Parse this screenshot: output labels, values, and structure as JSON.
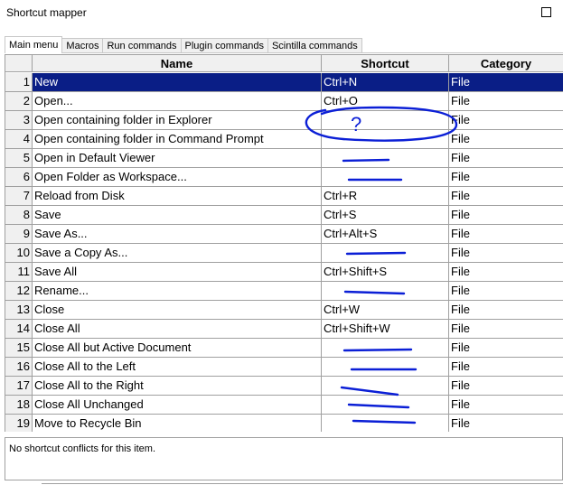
{
  "window": {
    "title": "Shortcut mapper"
  },
  "tabs": [
    {
      "label": "Main menu",
      "active": true
    },
    {
      "label": "Macros",
      "active": false
    },
    {
      "label": "Run commands",
      "active": false
    },
    {
      "label": "Plugin commands",
      "active": false
    },
    {
      "label": "Scintilla commands",
      "active": false
    }
  ],
  "table": {
    "columns": {
      "name": "Name",
      "shortcut": "Shortcut",
      "category": "Category"
    },
    "selected_row": 1,
    "rows": [
      {
        "num": "1",
        "name": "New",
        "shortcut": "Ctrl+N",
        "category": "File"
      },
      {
        "num": "2",
        "name": "Open...",
        "shortcut": "Ctrl+O",
        "category": "File"
      },
      {
        "num": "3",
        "name": "Open containing folder in Explorer",
        "shortcut": "",
        "category": "File"
      },
      {
        "num": "4",
        "name": "Open containing folder in Command Prompt",
        "shortcut": "",
        "category": "File"
      },
      {
        "num": "5",
        "name": "Open in Default Viewer",
        "shortcut": "",
        "category": "File"
      },
      {
        "num": "6",
        "name": "Open Folder as Workspace...",
        "shortcut": "",
        "category": "File"
      },
      {
        "num": "7",
        "name": "Reload from Disk",
        "shortcut": "Ctrl+R",
        "category": "File"
      },
      {
        "num": "8",
        "name": "Save",
        "shortcut": "Ctrl+S",
        "category": "File"
      },
      {
        "num": "9",
        "name": "Save As...",
        "shortcut": "Ctrl+Alt+S",
        "category": "File"
      },
      {
        "num": "10",
        "name": "Save a Copy As...",
        "shortcut": "",
        "category": "File"
      },
      {
        "num": "11",
        "name": "Save All",
        "shortcut": "Ctrl+Shift+S",
        "category": "File"
      },
      {
        "num": "12",
        "name": "Rename...",
        "shortcut": "",
        "category": "File"
      },
      {
        "num": "13",
        "name": "Close",
        "shortcut": "Ctrl+W",
        "category": "File"
      },
      {
        "num": "14",
        "name": "Close All",
        "shortcut": "Ctrl+Shift+W",
        "category": "File"
      },
      {
        "num": "15",
        "name": "Close All but Active Document",
        "shortcut": "",
        "category": "File"
      },
      {
        "num": "16",
        "name": "Close All to the Left",
        "shortcut": "",
        "category": "File"
      },
      {
        "num": "17",
        "name": "Close All to the Right",
        "shortcut": "",
        "category": "File"
      },
      {
        "num": "18",
        "name": "Close All Unchanged",
        "shortcut": "",
        "category": "File"
      },
      {
        "num": "19",
        "name": "Move to Recycle Bin",
        "shortcut": "",
        "category": "File"
      }
    ]
  },
  "status": {
    "text": "No shortcut conflicts for this item."
  },
  "annotations": {
    "question_mark": "?",
    "ink_color": "#0b1fd6"
  },
  "colors": {
    "selection": "#0a1e86",
    "header_bg": "#f0f0f0",
    "grid_line": "#a0a0a0"
  }
}
